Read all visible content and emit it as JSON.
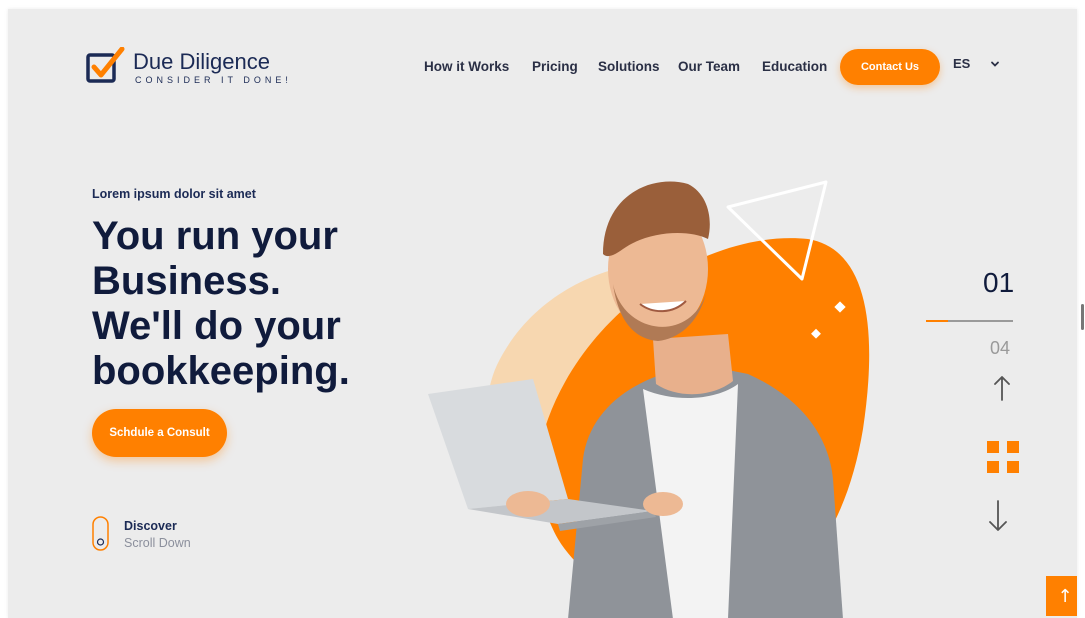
{
  "logo": {
    "title": "Due Diligence",
    "tagline": "CONSIDER IT DONE!",
    "icon": "checkbox-check-icon"
  },
  "nav": {
    "items": [
      "How it Works",
      "Pricing",
      "Solutions",
      "Our Team",
      "Education"
    ],
    "contact_label": "Contact Us",
    "language": "ES",
    "language_icon": "chevron-down-icon"
  },
  "hero": {
    "eyebrow": "Lorem ipsum dolor sit amet",
    "headline": [
      "You run your",
      "Business.",
      "We'll do your",
      "bookkeeping."
    ],
    "cta_label": "Schdule a Consult",
    "discover": "Discover",
    "scroll_down": "Scroll Down",
    "image_icon": "man-with-laptop-illustration"
  },
  "slider": {
    "current": "01",
    "total": "04",
    "progress": 0.25,
    "up_icon": "arrow-up-icon",
    "grid_icon": "grid-icon",
    "down_icon": "arrow-down-icon"
  },
  "back_to_top": {
    "label": "↑",
    "icon": "arrow-up-icon"
  },
  "colors": {
    "accent": "#ff8000",
    "navy": "#101b3c",
    "background": "#ececec"
  }
}
